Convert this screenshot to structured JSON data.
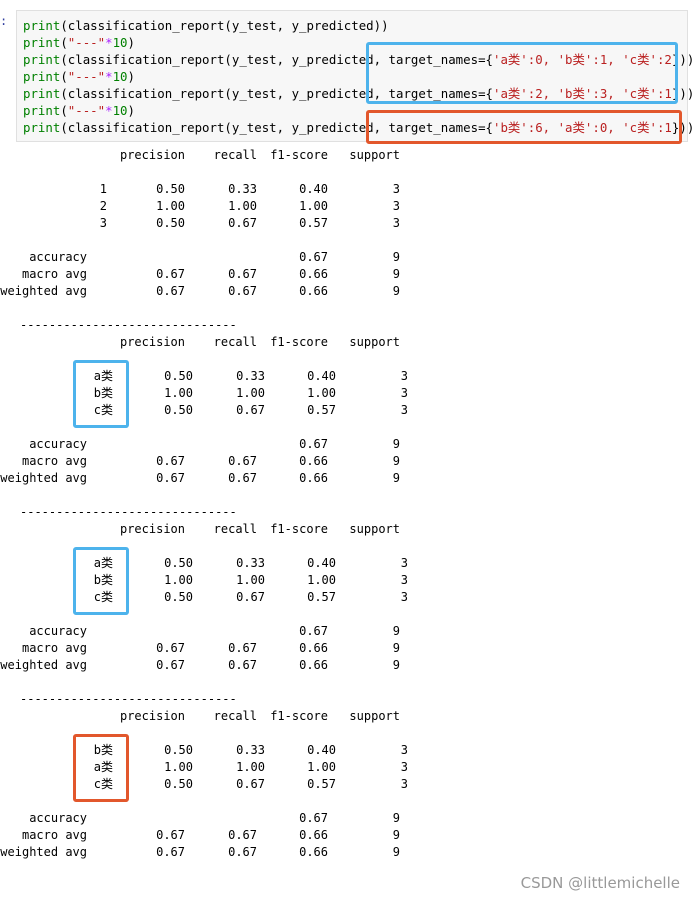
{
  "prompt_marker": ":",
  "code": {
    "lines": [
      {
        "fn": "print",
        "args": "(classification_report(y_test, y_predicted))"
      },
      {
        "fn": "print",
        "args_str": "\"---\"",
        "args_op": "*",
        "args_num": "10"
      },
      {
        "fn": "print",
        "args": "(classification_report(y_test, y_predicted, ",
        "tn_prefix": "target_names={",
        "tn_body": "'a类':0, 'b类':1, 'c类':2",
        "tn_suffix": "}))"
      },
      {
        "fn": "print",
        "args_str": "\"---\"",
        "args_op": "*",
        "args_num": "10"
      },
      {
        "fn": "print",
        "args": "(classification_report(y_test, y_predicted, ",
        "tn_prefix": "target_names={",
        "tn_body": "'a类':2, 'b类':3, 'c类':1",
        "tn_suffix": "}))"
      },
      {
        "fn": "print",
        "args_str": "\"---\"",
        "args_op": "*",
        "args_num": "10"
      },
      {
        "fn": "print",
        "args": "(classification_report(y_test, y_predicted, ",
        "tn_prefix": "target_names={",
        "tn_body": "'b类':6, 'a类':0, 'c类':1",
        "tn_suffix": "}))"
      }
    ]
  },
  "reports": [
    {
      "header": [
        "precision",
        "recall",
        "f1-score",
        "support"
      ],
      "rows": [
        {
          "label": "1",
          "p": "0.50",
          "r": "0.33",
          "f": "0.40",
          "s": "3"
        },
        {
          "label": "2",
          "p": "1.00",
          "r": "1.00",
          "f": "1.00",
          "s": "3"
        },
        {
          "label": "3",
          "p": "0.50",
          "r": "0.67",
          "f": "0.57",
          "s": "3"
        }
      ],
      "summary": [
        {
          "label": "accuracy",
          "p": "",
          "r": "",
          "f": "0.67",
          "s": "9"
        },
        {
          "label": "macro avg",
          "p": "0.67",
          "r": "0.67",
          "f": "0.66",
          "s": "9"
        },
        {
          "label": "weighted avg",
          "p": "0.67",
          "r": "0.67",
          "f": "0.66",
          "s": "9"
        }
      ]
    },
    {
      "separator": "------------------------------",
      "header": [
        "precision",
        "recall",
        "f1-score",
        "support"
      ],
      "rows": [
        {
          "label": "a类",
          "p": "0.50",
          "r": "0.33",
          "f": "0.40",
          "s": "3"
        },
        {
          "label": "b类",
          "p": "1.00",
          "r": "1.00",
          "f": "1.00",
          "s": "3"
        },
        {
          "label": "c类",
          "p": "0.50",
          "r": "0.67",
          "f": "0.57",
          "s": "3"
        }
      ],
      "summary": [
        {
          "label": "accuracy",
          "p": "",
          "r": "",
          "f": "0.67",
          "s": "9"
        },
        {
          "label": "macro avg",
          "p": "0.67",
          "r": "0.67",
          "f": "0.66",
          "s": "9"
        },
        {
          "label": "weighted avg",
          "p": "0.67",
          "r": "0.67",
          "f": "0.66",
          "s": "9"
        }
      ]
    },
    {
      "separator": "------------------------------",
      "header": [
        "precision",
        "recall",
        "f1-score",
        "support"
      ],
      "rows": [
        {
          "label": "a类",
          "p": "0.50",
          "r": "0.33",
          "f": "0.40",
          "s": "3"
        },
        {
          "label": "b类",
          "p": "1.00",
          "r": "1.00",
          "f": "1.00",
          "s": "3"
        },
        {
          "label": "c类",
          "p": "0.50",
          "r": "0.67",
          "f": "0.57",
          "s": "3"
        }
      ],
      "summary": [
        {
          "label": "accuracy",
          "p": "",
          "r": "",
          "f": "0.67",
          "s": "9"
        },
        {
          "label": "macro avg",
          "p": "0.67",
          "r": "0.67",
          "f": "0.66",
          "s": "9"
        },
        {
          "label": "weighted avg",
          "p": "0.67",
          "r": "0.67",
          "f": "0.66",
          "s": "9"
        }
      ]
    },
    {
      "separator": "------------------------------",
      "header": [
        "precision",
        "recall",
        "f1-score",
        "support"
      ],
      "rows": [
        {
          "label": "b类",
          "p": "0.50",
          "r": "0.33",
          "f": "0.40",
          "s": "3"
        },
        {
          "label": "a类",
          "p": "1.00",
          "r": "1.00",
          "f": "1.00",
          "s": "3"
        },
        {
          "label": "c类",
          "p": "0.50",
          "r": "0.67",
          "f": "0.57",
          "s": "3"
        }
      ],
      "summary": [
        {
          "label": "accuracy",
          "p": "",
          "r": "",
          "f": "0.67",
          "s": "9"
        },
        {
          "label": "macro avg",
          "p": "0.67",
          "r": "0.67",
          "f": "0.66",
          "s": "9"
        },
        {
          "label": "weighted avg",
          "p": "0.67",
          "r": "0.67",
          "f": "0.66",
          "s": "9"
        }
      ]
    }
  ],
  "highlight_colors": {
    "blue": "#4db3ec",
    "orange": "#e2572c"
  },
  "watermark": "CSDN @littlemichelle"
}
